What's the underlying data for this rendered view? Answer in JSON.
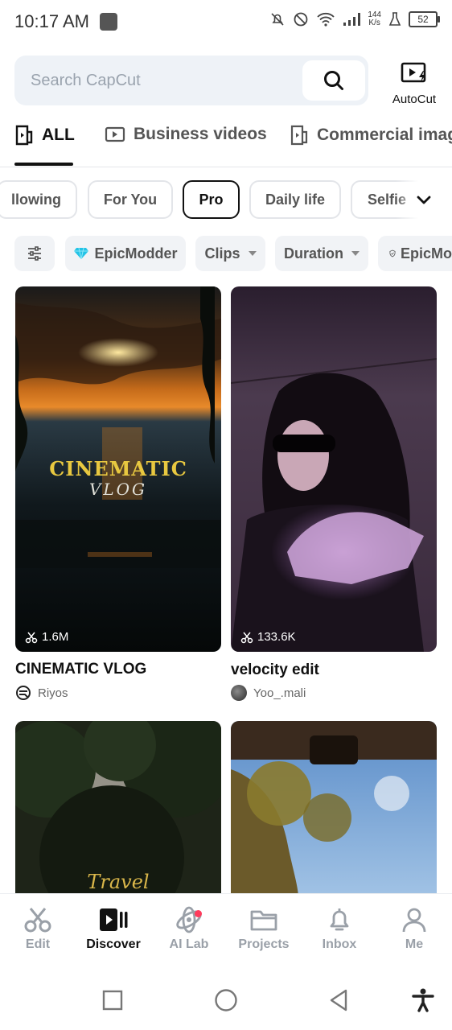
{
  "status_bar": {
    "time": "10:17 AM",
    "net_speed_top": "144",
    "net_speed_bottom": "K/s",
    "battery": "52"
  },
  "search": {
    "placeholder": "Search CapCut"
  },
  "autocut": {
    "label": "AutoCut"
  },
  "tabs": [
    {
      "label": "ALL",
      "active": true
    },
    {
      "label": "Business videos",
      "active": false
    },
    {
      "label": "Commercial imag",
      "active": false
    }
  ],
  "categories": [
    {
      "label": "llowing"
    },
    {
      "label": "For You"
    },
    {
      "label": "Pro",
      "active": true
    },
    {
      "label": "Daily life"
    },
    {
      "label": "Selfie"
    }
  ],
  "filters": [
    {
      "label": "EpicModder",
      "icon": "diamond-icon"
    },
    {
      "label": "Clips"
    },
    {
      "label": "Duration"
    },
    {
      "label": "EpicMo",
      "icon": "shield-icon"
    }
  ],
  "cards": [
    {
      "title": "CINEMATIC VLOG",
      "uses": "1.6M",
      "author": "Riyos",
      "overlay_line1": "CINEMATIC",
      "overlay_line2": "VLOG"
    },
    {
      "title": "velocity edit",
      "uses": "133.6K",
      "author": "Yoo_.mali"
    },
    {
      "overlay": "Travel"
    },
    {}
  ],
  "bottom_nav": [
    {
      "label": "Edit",
      "icon": "scissors-icon"
    },
    {
      "label": "Discover",
      "icon": "discover-icon",
      "active": true
    },
    {
      "label": "AI Lab",
      "icon": "ai-lab-icon",
      "badge": true
    },
    {
      "label": "Projects",
      "icon": "folder-icon"
    },
    {
      "label": "Inbox",
      "icon": "bell-icon"
    },
    {
      "label": "Me",
      "icon": "person-icon"
    }
  ],
  "colors": {
    "accent": "#111111",
    "badge": "#ff3b5c",
    "search_bg": "#eef2f7",
    "inactive": "#9aa0a8"
  }
}
